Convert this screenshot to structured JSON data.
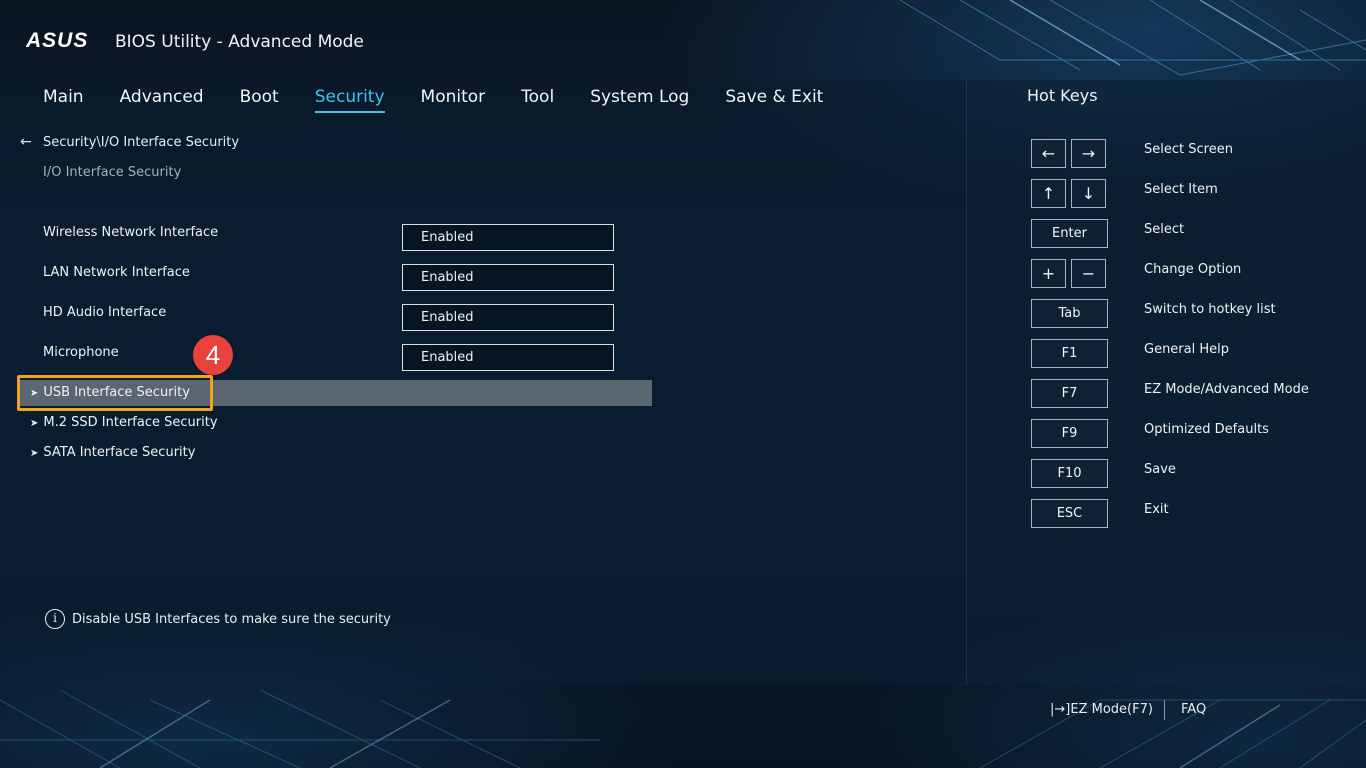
{
  "header": {
    "logo_text": "ASUS",
    "app_title": "BIOS Utility - Advanced Mode"
  },
  "tabs": [
    {
      "label": "Main",
      "active": false
    },
    {
      "label": "Advanced",
      "active": false
    },
    {
      "label": "Boot",
      "active": false
    },
    {
      "label": "Security",
      "active": true
    },
    {
      "label": "Monitor",
      "active": false
    },
    {
      "label": "Tool",
      "active": false
    },
    {
      "label": "System Log",
      "active": false
    },
    {
      "label": "Save & Exit",
      "active": false
    }
  ],
  "breadcrumb": {
    "path": "Security\\I/O Interface Security",
    "subtitle": "I/O Interface Security"
  },
  "settings": [
    {
      "label": "Wireless Network Interface",
      "value": "Enabled"
    },
    {
      "label": "LAN Network Interface",
      "value": "Enabled"
    },
    {
      "label": "HD Audio Interface",
      "value": "Enabled"
    },
    {
      "label": "Microphone",
      "value": "Enabled"
    }
  ],
  "submenus": [
    {
      "label": "USB Interface Security",
      "selected": true
    },
    {
      "label": "M.2 SSD Interface Security",
      "selected": false
    },
    {
      "label": "SATA Interface Security",
      "selected": false
    }
  ],
  "annotation": {
    "step": "4",
    "color": "#f3a21c",
    "badge_color": "#e8423a"
  },
  "help": {
    "text": "Disable USB Interfaces to make sure the security"
  },
  "hotkeys": {
    "title": "Hot Keys",
    "items": [
      {
        "keys": [
          "←",
          "→"
        ],
        "description": "Select Screen"
      },
      {
        "keys": [
          "↑",
          "↓"
        ],
        "description": "Select Item"
      },
      {
        "keys": [
          "Enter"
        ],
        "description": "Select"
      },
      {
        "keys": [
          "+",
          "−"
        ],
        "description": "Change Option"
      },
      {
        "keys": [
          "Tab"
        ],
        "description": "Switch to hotkey list"
      },
      {
        "keys": [
          "F1"
        ],
        "description": "General Help"
      },
      {
        "keys": [
          "F7"
        ],
        "description": "EZ Mode/Advanced Mode"
      },
      {
        "keys": [
          "F9"
        ],
        "description": "Optimized Defaults"
      },
      {
        "keys": [
          "F10"
        ],
        "description": "Save"
      },
      {
        "keys": [
          "ESC"
        ],
        "description": "Exit"
      }
    ]
  },
  "footer": {
    "ez_mode": "EZ Mode(F7)",
    "faq": "FAQ"
  },
  "colors": {
    "accent": "#3fc3f0",
    "highlight": "#5a6670",
    "background": "#0b1a2b"
  }
}
